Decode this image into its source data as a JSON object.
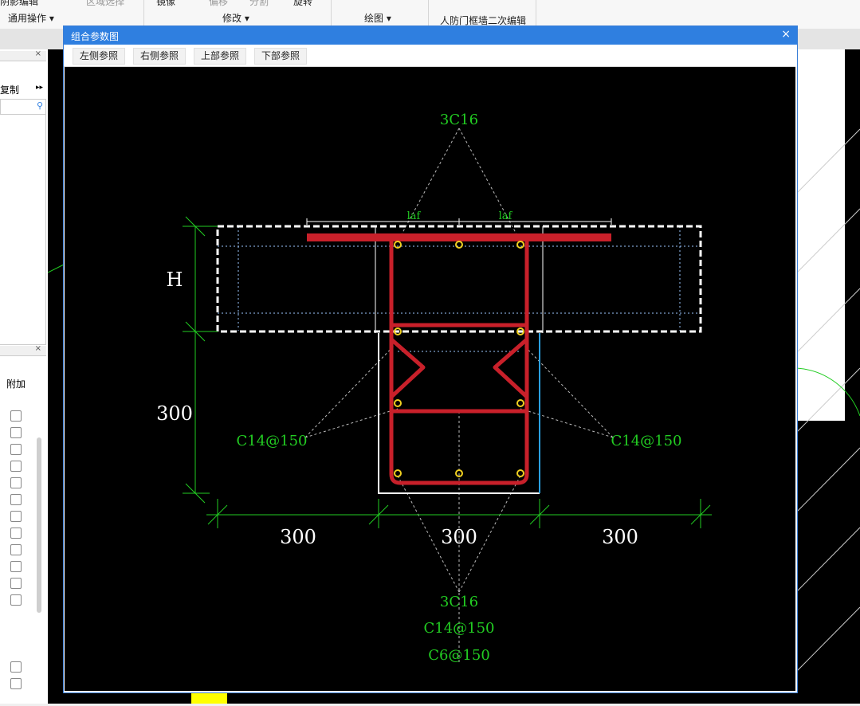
{
  "ribbon": {
    "groups": [
      "通用操作",
      "修改",
      "绘图",
      "人防门框墙二次编辑"
    ],
    "top_items": [
      "阴影编辑",
      "区域选择",
      "镜像",
      "偏移",
      "分割",
      "旋转"
    ]
  },
  "left_panel": {
    "copy_label": "复制",
    "column_header": "附加"
  },
  "dialog": {
    "title": "组合参数图",
    "close": "×",
    "buttons": [
      "左侧参照",
      "右侧参照",
      "上部参照",
      "下部参照"
    ]
  },
  "drawing": {
    "dims": {
      "h_label": "H",
      "v_bottom": "300",
      "h_left": "300",
      "h_mid": "300",
      "h_right": "300"
    },
    "laf": [
      "laf",
      "laf"
    ],
    "rebar": {
      "top": "3C16",
      "left": "C14@150",
      "right": "C14@150",
      "bottom1": "3C16",
      "bottom2": "C14@150",
      "bottom3": "C6@150"
    },
    "colors": {
      "rebar": "#c8202a",
      "dim": "#22cc22",
      "bar_dot": "#f0d020",
      "outline": "#ffffff",
      "edge_blue": "#2aa0e0"
    }
  }
}
